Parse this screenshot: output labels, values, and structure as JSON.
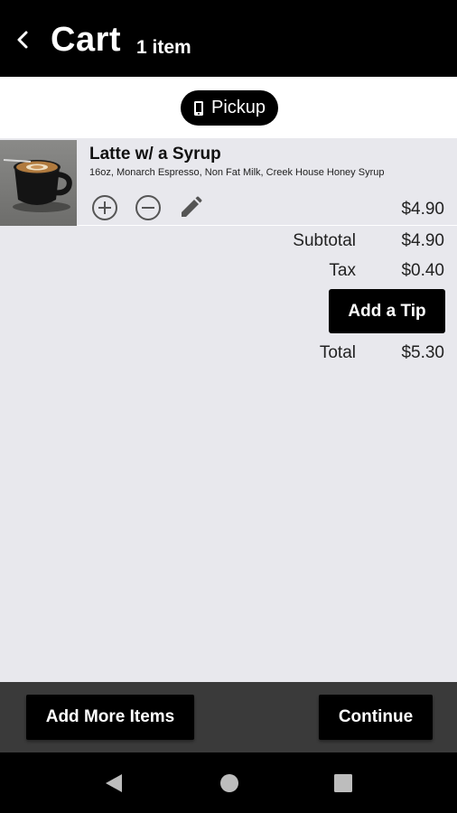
{
  "header": {
    "title": "Cart",
    "count": "1 item"
  },
  "order_type": {
    "label": "Pickup"
  },
  "items": [
    {
      "name": "Latte w/ a Syrup",
      "description": "16oz, Monarch Espresso, Non Fat Milk, Creek House Honey Syrup",
      "price": "$4.90"
    }
  ],
  "totals": {
    "subtotal_label": "Subtotal",
    "subtotal_value": "$4.90",
    "tax_label": "Tax",
    "tax_value": "$0.40",
    "tip_button": "Add a Tip",
    "total_label": "Total",
    "total_value": "$5.30"
  },
  "actions": {
    "add_more": "Add More Items",
    "continue": "Continue"
  },
  "icons": {
    "back": "back-arrow-icon",
    "pickup": "phone-icon",
    "add": "plus-circle-icon",
    "remove": "minus-circle-icon",
    "edit": "pencil-icon",
    "nav_back": "triangle-back-icon",
    "nav_home": "circle-home-icon",
    "nav_recents": "square-recents-icon"
  },
  "colors": {
    "header_bg": "#000000",
    "page_bg": "#e8e8ed",
    "action_bar_bg": "#3a3a3a",
    "button_bg": "#000000"
  }
}
